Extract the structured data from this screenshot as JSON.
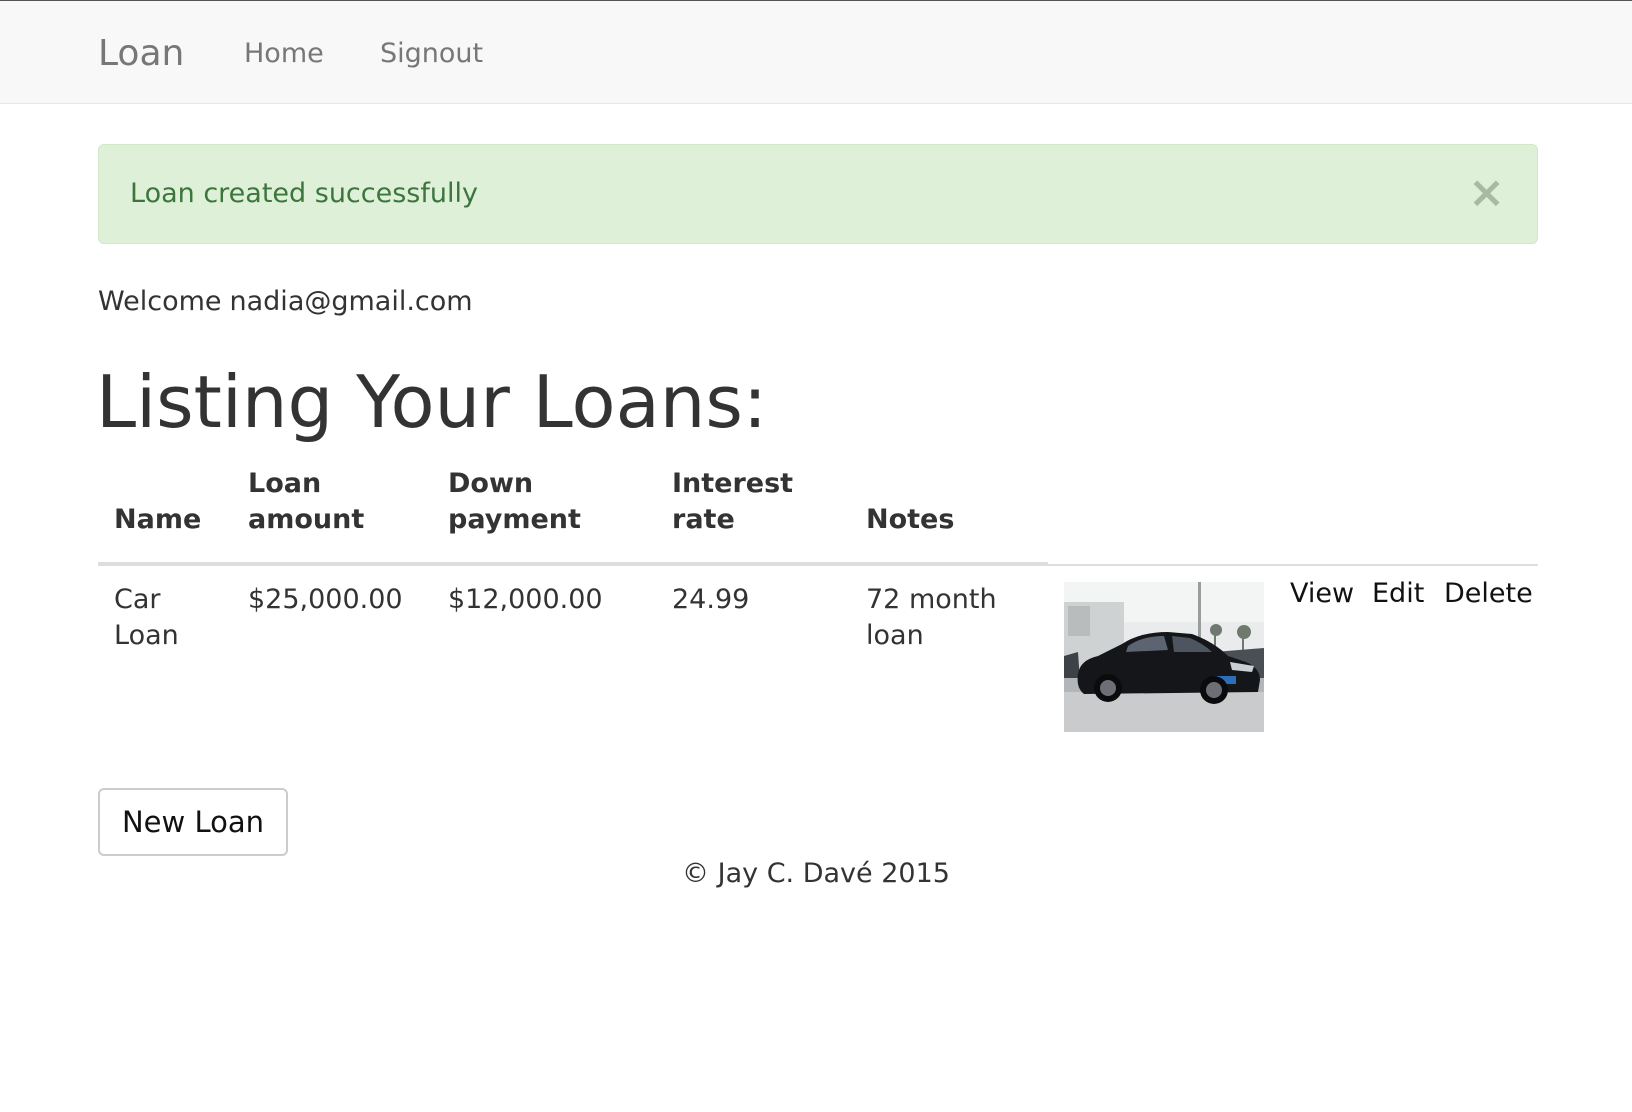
{
  "navbar": {
    "brand": "Loan",
    "links": [
      "Home",
      "Signout"
    ]
  },
  "alert": {
    "message": "Loan created successfully",
    "close_symbol": "×"
  },
  "welcome": {
    "prefix": "Welcome",
    "email": "nadia@gmail.com"
  },
  "page_title": "Listing Your Loans:",
  "table": {
    "headers": {
      "name": "Name",
      "loan_amount": [
        "Loan",
        "amount"
      ],
      "down_payment": [
        "Down",
        "payment"
      ],
      "interest_rate": [
        "Interest",
        "rate"
      ],
      "notes": "Notes"
    },
    "rows": [
      {
        "name": [
          "Car",
          "Loan"
        ],
        "loan_amount": "$25,000.00",
        "down_payment": "$12,000.00",
        "interest_rate": "24.99",
        "notes": [
          "72 month",
          "loan"
        ],
        "image": "black-sedan-car-photo",
        "actions": [
          "View",
          "Edit",
          "Delete"
        ]
      }
    ]
  },
  "new_loan_button": "New Loan",
  "footer": "© Jay C. Davé 2015"
}
